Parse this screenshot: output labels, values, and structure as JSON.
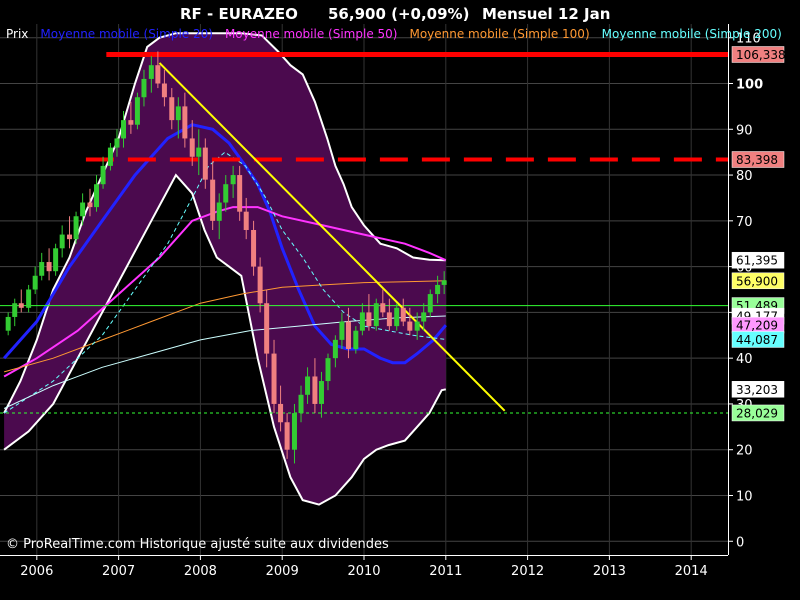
{
  "chart_data": {
    "type": "candlestick",
    "title": "RF - EURAZEO",
    "price_label": "56,900 (+0,09%)",
    "period_label": "Mensuel  12 Jan",
    "credit": "© ProRealTime.com Historique ajusté suite aux dividendes",
    "legend": [
      {
        "label": "Prix",
        "color": "#ffffff"
      },
      {
        "label": "Moyenne mobile (Simple 20)",
        "color": "#2222ff"
      },
      {
        "label": "Moyenne mobile (Simple 50)",
        "color": "#ff33ff"
      },
      {
        "label": "Moyenne mobile (Simple 100)",
        "color": "#ff9933"
      },
      {
        "label": "Moyenne mobile (Simple 200)",
        "color": "#66ffff"
      }
    ],
    "x_range": [
      2005.55,
      2014.45
    ],
    "y_range": [
      -3,
      113
    ],
    "x_ticks": [
      {
        "value": 2006,
        "label": "2006"
      },
      {
        "value": 2007,
        "label": "2007"
      },
      {
        "value": 2008,
        "label": "2008"
      },
      {
        "value": 2009,
        "label": "2009"
      },
      {
        "value": 2010,
        "label": "2010"
      },
      {
        "value": 2011,
        "label": "2011"
      },
      {
        "value": 2012,
        "label": "2012"
      },
      {
        "value": 2013,
        "label": "2013"
      },
      {
        "value": 2014,
        "label": "2014"
      }
    ],
    "y_ticks": [
      {
        "value": 0,
        "label": "0"
      },
      {
        "value": 10,
        "label": "10"
      },
      {
        "value": 20,
        "label": "20"
      },
      {
        "value": 30,
        "label": "30"
      },
      {
        "value": 40,
        "label": "40"
      },
      {
        "value": 50,
        "label": "50"
      },
      {
        "value": 60,
        "label": "60"
      },
      {
        "value": 70,
        "label": "70"
      },
      {
        "value": 80,
        "label": "80"
      },
      {
        "value": 90,
        "label": "90"
      },
      {
        "value": 100,
        "label": "100"
      },
      {
        "value": 110,
        "label": "110"
      }
    ],
    "price_badges": [
      {
        "value": 106.338,
        "label": "106,338",
        "bg": "#f08080"
      },
      {
        "value": 83.398,
        "label": "83,398",
        "bg": "#f08080"
      },
      {
        "value": 61.395,
        "label": "61,395",
        "bg": "#ffffff"
      },
      {
        "value": 56.9,
        "label": "56,900",
        "bg": "#ffff66"
      },
      {
        "value": 51.489,
        "label": "51,489",
        "bg": "#99ff99"
      },
      {
        "value": 49.177,
        "label": "49,177",
        "bg": "#ffffff"
      },
      {
        "value": 47.209,
        "label": "47,209",
        "bg": "#ff99ff"
      },
      {
        "value": 44.087,
        "label": "44,087",
        "bg": "#66ffff"
      },
      {
        "value": 33.203,
        "label": "33,203",
        "bg": "#ffffff"
      },
      {
        "value": 28.029,
        "label": "28,029",
        "bg": "#99ff99"
      }
    ],
    "horizontal_lines": [
      {
        "value": 106.338,
        "color": "#ff0000",
        "style": "solid",
        "x_from": 2006.85
      },
      {
        "value": 83.398,
        "color": "#ff0000",
        "style": "dashed",
        "x_from": 2006.6
      },
      {
        "value": 51.489,
        "color": "#33ff33",
        "style": "solid",
        "x_from": 2005.55
      },
      {
        "value": 28.029,
        "color": "#33ff33",
        "style": "dotted",
        "x_from": 2005.55
      }
    ],
    "trendline": {
      "x1": 2007.5,
      "y1": 104.5,
      "x2": 2011.72,
      "y2": 28.5,
      "color": "#ffff00"
    },
    "bollinger_upper": [
      [
        2005.6,
        28
      ],
      [
        2005.8,
        35
      ],
      [
        2006.0,
        44
      ],
      [
        2006.2,
        55
      ],
      [
        2006.4,
        62
      ],
      [
        2006.6,
        72
      ],
      [
        2006.8,
        80
      ],
      [
        2007.0,
        88
      ],
      [
        2007.2,
        100
      ],
      [
        2007.35,
        108
      ],
      [
        2007.5,
        110
      ],
      [
        2007.7,
        111
      ],
      [
        2008.0,
        111
      ],
      [
        2008.2,
        111
      ],
      [
        2008.5,
        111
      ],
      [
        2008.75,
        110.5
      ],
      [
        2008.95,
        107
      ],
      [
        2009.1,
        104
      ],
      [
        2009.25,
        102
      ],
      [
        2009.4,
        96
      ],
      [
        2009.55,
        88
      ],
      [
        2009.65,
        82
      ],
      [
        2009.75,
        78
      ],
      [
        2009.85,
        73
      ],
      [
        2010.0,
        69
      ],
      [
        2010.2,
        65
      ],
      [
        2010.4,
        64
      ],
      [
        2010.6,
        62
      ],
      [
        2010.8,
        61.5
      ],
      [
        2011.0,
        61.4
      ]
    ],
    "bollinger_lower": [
      [
        2005.6,
        20
      ],
      [
        2005.9,
        24
      ],
      [
        2006.2,
        30
      ],
      [
        2006.5,
        40
      ],
      [
        2006.8,
        50
      ],
      [
        2007.1,
        60
      ],
      [
        2007.4,
        70
      ],
      [
        2007.7,
        80
      ],
      [
        2007.9,
        76
      ],
      [
        2008.05,
        68
      ],
      [
        2008.2,
        62
      ],
      [
        2008.35,
        60
      ],
      [
        2008.5,
        58
      ],
      [
        2008.7,
        40
      ],
      [
        2008.9,
        25
      ],
      [
        2009.1,
        14
      ],
      [
        2009.25,
        9
      ],
      [
        2009.45,
        8
      ],
      [
        2009.65,
        10
      ],
      [
        2009.85,
        14
      ],
      [
        2010.0,
        18
      ],
      [
        2010.15,
        20
      ],
      [
        2010.3,
        21
      ],
      [
        2010.5,
        22
      ],
      [
        2010.65,
        25
      ],
      [
        2010.8,
        28
      ],
      [
        2010.95,
        33
      ],
      [
        2011.0,
        33.2
      ]
    ],
    "series": [
      {
        "name": "Moyenne mobile (Simple 20)",
        "color": "#2222ff",
        "width": 3,
        "dash": "",
        "points": [
          [
            2005.6,
            40
          ],
          [
            2006.0,
            48
          ],
          [
            2006.4,
            60
          ],
          [
            2006.8,
            70
          ],
          [
            2007.2,
            80
          ],
          [
            2007.6,
            88
          ],
          [
            2007.9,
            91
          ],
          [
            2008.15,
            90
          ],
          [
            2008.35,
            87
          ],
          [
            2008.55,
            82
          ],
          [
            2008.7,
            78
          ],
          [
            2008.85,
            72
          ],
          [
            2009.0,
            64
          ],
          [
            2009.2,
            55
          ],
          [
            2009.4,
            47
          ],
          [
            2009.6,
            43
          ],
          [
            2009.8,
            42
          ],
          [
            2010.0,
            42
          ],
          [
            2010.2,
            40
          ],
          [
            2010.35,
            39
          ],
          [
            2010.5,
            39
          ],
          [
            2010.65,
            41
          ],
          [
            2010.85,
            44
          ],
          [
            2011.0,
            47.2
          ]
        ]
      },
      {
        "name": "Moyenne mobile (Simple 50)",
        "color": "#ff33ff",
        "width": 2,
        "dash": "",
        "points": [
          [
            2005.6,
            36
          ],
          [
            2006.0,
            40
          ],
          [
            2006.5,
            46
          ],
          [
            2007.0,
            54
          ],
          [
            2007.5,
            62
          ],
          [
            2007.9,
            70
          ],
          [
            2008.2,
            72
          ],
          [
            2008.4,
            73
          ],
          [
            2008.7,
            73
          ],
          [
            2009.0,
            71
          ],
          [
            2009.5,
            69
          ],
          [
            2010.0,
            67
          ],
          [
            2010.5,
            65
          ],
          [
            2010.8,
            63
          ],
          [
            2011.0,
            61.4
          ]
        ]
      },
      {
        "name": "Moyenne mobile (Simple 100)",
        "color": "#ff9933",
        "width": 1,
        "dash": "",
        "points": [
          [
            2005.6,
            37
          ],
          [
            2006.2,
            40
          ],
          [
            2006.8,
            44
          ],
          [
            2007.4,
            48
          ],
          [
            2008.0,
            52
          ],
          [
            2008.5,
            54
          ],
          [
            2009.0,
            55.5
          ],
          [
            2009.5,
            56
          ],
          [
            2010.0,
            56.5
          ],
          [
            2010.5,
            56.7
          ],
          [
            2011.0,
            56.9
          ]
        ]
      },
      {
        "name": "Moyenne mobile (Simple 200)",
        "color": "#66ffff",
        "width": 1,
        "dash": "4 3",
        "points": [
          [
            2005.6,
            28
          ],
          [
            2006.2,
            35
          ],
          [
            2006.8,
            45
          ],
          [
            2007.2,
            55
          ],
          [
            2007.6,
            65
          ],
          [
            2007.9,
            75
          ],
          [
            2008.1,
            82
          ],
          [
            2008.3,
            85
          ],
          [
            2008.55,
            82
          ],
          [
            2008.8,
            75
          ],
          [
            2009.0,
            68
          ],
          [
            2009.25,
            62
          ],
          [
            2009.5,
            55
          ],
          [
            2009.75,
            50
          ],
          [
            2010.0,
            47
          ],
          [
            2010.3,
            46
          ],
          [
            2010.6,
            45
          ],
          [
            2011.0,
            44.1
          ]
        ]
      },
      {
        "name": "",
        "color": "#ccffff",
        "width": 1,
        "dash": "",
        "points": [
          [
            2005.6,
            29
          ],
          [
            2006.2,
            34
          ],
          [
            2006.8,
            38
          ],
          [
            2007.4,
            41
          ],
          [
            2008.0,
            44
          ],
          [
            2008.6,
            46
          ],
          [
            2009.2,
            47
          ],
          [
            2009.8,
            48
          ],
          [
            2010.4,
            48.8
          ],
          [
            2011.0,
            49.2
          ]
        ]
      }
    ],
    "candles": [
      [
        2005.65,
        46,
        50,
        45,
        49
      ],
      [
        2005.73,
        49,
        53,
        47,
        52
      ],
      [
        2005.81,
        52,
        55,
        50,
        51
      ],
      [
        2005.9,
        51,
        56,
        50,
        55
      ],
      [
        2005.98,
        55,
        60,
        54,
        58
      ],
      [
        2006.06,
        58,
        63,
        57,
        61
      ],
      [
        2006.15,
        61,
        64,
        57,
        59
      ],
      [
        2006.23,
        59,
        65,
        58,
        64
      ],
      [
        2006.31,
        64,
        69,
        62,
        67
      ],
      [
        2006.4,
        67,
        71,
        64,
        66
      ],
      [
        2006.48,
        66,
        72,
        65,
        71
      ],
      [
        2006.56,
        71,
        76,
        69,
        74
      ],
      [
        2006.65,
        74,
        77,
        71,
        73
      ],
      [
        2006.73,
        73,
        80,
        72,
        78
      ],
      [
        2006.81,
        78,
        84,
        77,
        82
      ],
      [
        2006.9,
        82,
        87,
        81,
        86
      ],
      [
        2006.98,
        86,
        90,
        84,
        88
      ],
      [
        2007.06,
        88,
        94,
        86,
        92
      ],
      [
        2007.15,
        92,
        96,
        89,
        91
      ],
      [
        2007.23,
        91,
        98,
        90,
        97
      ],
      [
        2007.31,
        97,
        103,
        95,
        101
      ],
      [
        2007.4,
        101,
        106,
        98,
        104
      ],
      [
        2007.48,
        104,
        107,
        99,
        100
      ],
      [
        2007.56,
        100,
        103,
        95,
        97
      ],
      [
        2007.65,
        97,
        99,
        90,
        92
      ],
      [
        2007.73,
        92,
        97,
        88,
        95
      ],
      [
        2007.81,
        95,
        98,
        86,
        88
      ],
      [
        2007.9,
        88,
        92,
        82,
        84
      ],
      [
        2007.98,
        84,
        90,
        80,
        86
      ],
      [
        2008.06,
        86,
        88,
        77,
        79
      ],
      [
        2008.15,
        79,
        83,
        68,
        70
      ],
      [
        2008.23,
        70,
        76,
        66,
        74
      ],
      [
        2008.31,
        74,
        80,
        72,
        78
      ],
      [
        2008.4,
        78,
        82,
        75,
        80
      ],
      [
        2008.48,
        80,
        82,
        70,
        72
      ],
      [
        2008.56,
        72,
        75,
        66,
        68
      ],
      [
        2008.65,
        68,
        70,
        58,
        60
      ],
      [
        2008.73,
        60,
        62,
        50,
        52
      ],
      [
        2008.81,
        52,
        55,
        38,
        41
      ],
      [
        2008.9,
        41,
        44,
        28,
        30
      ],
      [
        2008.98,
        30,
        34,
        24,
        26
      ],
      [
        2009.06,
        26,
        28,
        18,
        20
      ],
      [
        2009.15,
        20,
        30,
        17,
        28
      ],
      [
        2009.23,
        28,
        34,
        26,
        32
      ],
      [
        2009.31,
        32,
        38,
        30,
        36
      ],
      [
        2009.4,
        36,
        40,
        28,
        30
      ],
      [
        2009.48,
        30,
        37,
        27,
        35
      ],
      [
        2009.56,
        35,
        41,
        33,
        40
      ],
      [
        2009.65,
        40,
        45,
        38,
        44
      ],
      [
        2009.73,
        44,
        50,
        42,
        48
      ],
      [
        2009.81,
        48,
        51,
        40,
        42
      ],
      [
        2009.9,
        42,
        47,
        41,
        46
      ],
      [
        2009.98,
        46,
        52,
        45,
        50
      ],
      [
        2010.06,
        50,
        54,
        46,
        47
      ],
      [
        2010.15,
        47,
        53,
        46,
        52
      ],
      [
        2010.23,
        52,
        55,
        49,
        50
      ],
      [
        2010.31,
        50,
        53,
        46,
        47
      ],
      [
        2010.4,
        47,
        52,
        46,
        51
      ],
      [
        2010.48,
        51,
        53,
        47,
        48
      ],
      [
        2010.56,
        48,
        51,
        45,
        46
      ],
      [
        2010.65,
        46,
        50,
        44,
        48
      ],
      [
        2010.73,
        48,
        52,
        46,
        50
      ],
      [
        2010.81,
        50,
        55,
        49,
        54
      ],
      [
        2010.9,
        54,
        58,
        52,
        56
      ],
      [
        2010.98,
        56,
        59,
        54,
        57
      ]
    ]
  }
}
